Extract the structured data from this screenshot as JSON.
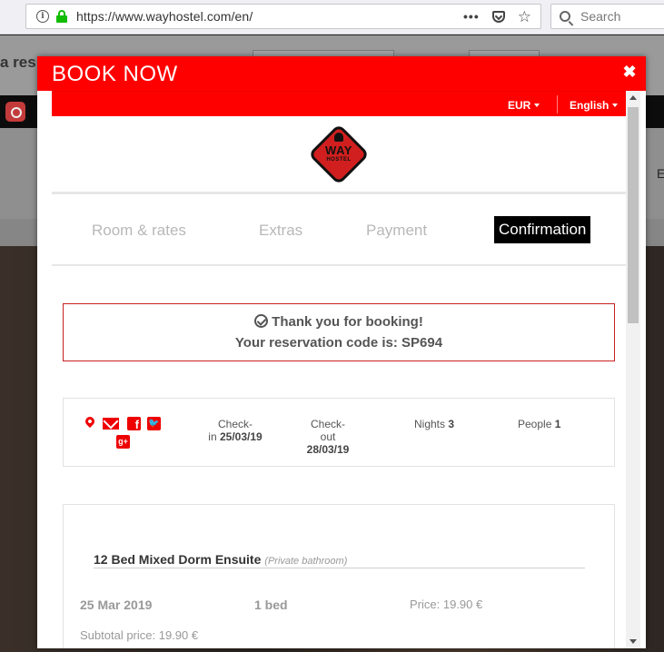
{
  "browser": {
    "url": "https://www.wayhostel.com/en/",
    "info_glyph": "i",
    "more_glyph": "•••",
    "star_glyph": "☆",
    "search_placeholder": "Search"
  },
  "background": {
    "heading_fragment": "a res",
    "side_fragment": "E"
  },
  "modal": {
    "title": "BOOK NOW",
    "close_glyph": "✖"
  },
  "topbar": {
    "currency": "EUR",
    "language": "English"
  },
  "logo": {
    "name": "WAY",
    "sub": "HOSTEL"
  },
  "steps": [
    {
      "label": "Room & rates"
    },
    {
      "label": "Extras"
    },
    {
      "label": "Payment"
    },
    {
      "label": "Confirmation"
    }
  ],
  "confirmation": {
    "thanks": "Thank you for booking!",
    "code_label": "Your reservation code is:",
    "code": "SP694"
  },
  "share_icons": [
    "map-pin-icon",
    "mail-icon",
    "facebook-icon",
    "twitter-icon",
    "google-plus-icon"
  ],
  "share_glyphs": {
    "facebook": "f",
    "twitter": "🐦",
    "google_plus": "g+"
  },
  "stay": {
    "checkin_label_1": "Check-",
    "checkin_label_2": "in",
    "checkin_value": "25/03/19",
    "checkout_label_1": "Check-",
    "checkout_label_2": "out",
    "checkout_value": "28/03/19",
    "nights_label": "Nights",
    "nights_value": "3",
    "people_label": "People",
    "people_value": "1"
  },
  "room": {
    "name": "12 Bed Mixed Dorm Ensuite",
    "note": "(Private bathroom)",
    "date": "25 Mar 2019",
    "beds": "1 bed",
    "price_label": "Price:",
    "price_value": "19.90 €",
    "subtotal": "Subtotal price: 19.90 €"
  },
  "colors": {
    "brand_red": "#ff0000",
    "share_red": "#e00000",
    "border_red": "#c82020",
    "secure_green": "#12bc00"
  }
}
